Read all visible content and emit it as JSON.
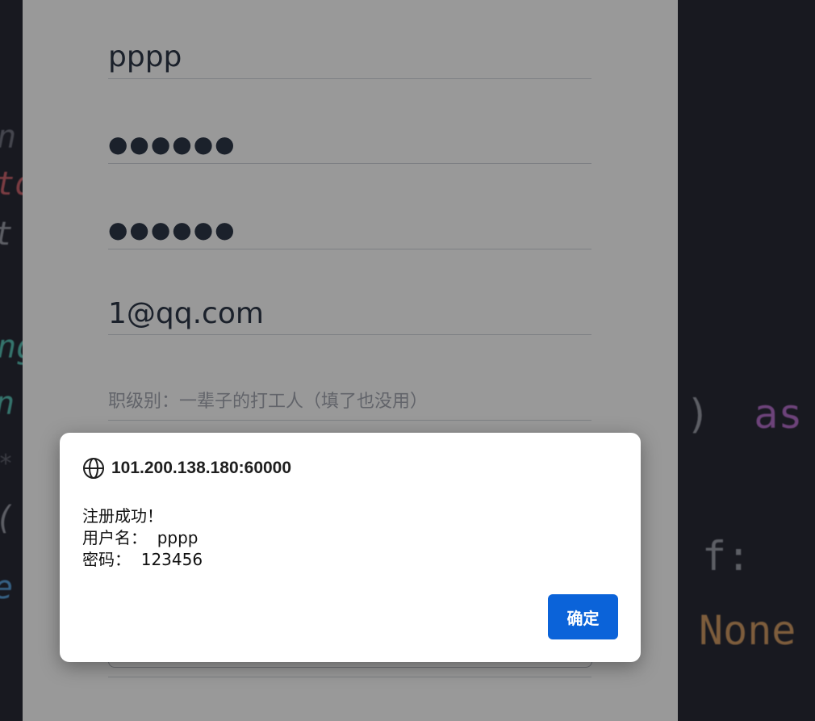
{
  "background_code": {
    "left_fragments": [
      "n",
      "to",
      "t",
      "ng",
      "n",
      "*",
      "(",
      "e"
    ],
    "right_fragments": {
      "line1_paren": ")",
      "line1_keyword": "as",
      "line2": "f:",
      "line3": "None"
    }
  },
  "form": {
    "username_value": "pppp",
    "password_mask": "●●●●●●",
    "confirm_password_mask": "●●●●●●",
    "email_value": "1@qq.com",
    "level_placeholder": "职级别：一辈子的打工人（填了也没用）"
  },
  "dialog": {
    "icon": "globe-icon",
    "origin": "101.200.138.180:60000",
    "message_lines": [
      "注册成功！",
      "用户名：  pppp",
      "密码：  123456"
    ],
    "ok_label": "确定"
  },
  "colors": {
    "accent": "#0b63d9",
    "overlay": "rgba(0,0,0,0.40)",
    "code_bg": "#282a36"
  }
}
